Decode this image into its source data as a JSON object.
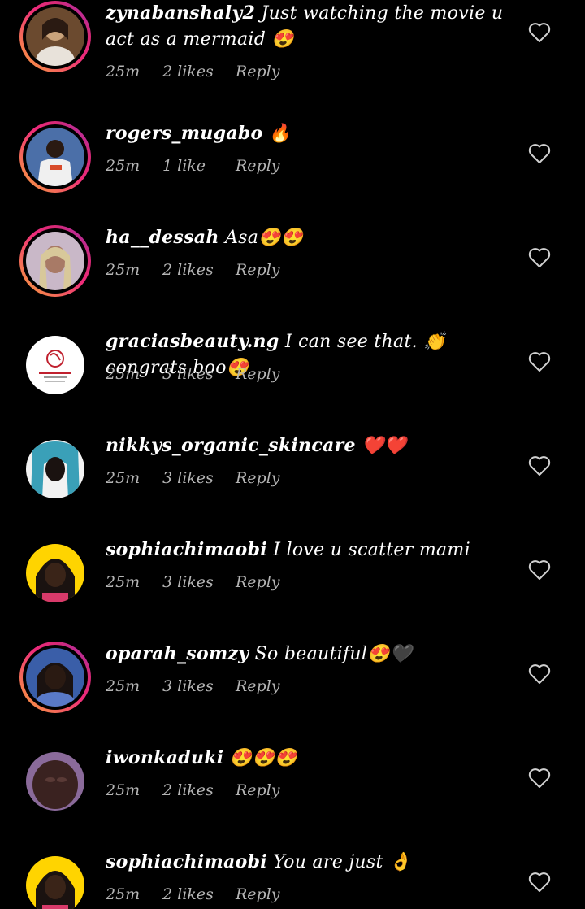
{
  "comments": [
    {
      "username": "zynabanshaly2",
      "text": "Just watching the movie u act as a mermaid 😍",
      "time": "25m",
      "likes": "2 likes",
      "reply": "Reply",
      "story": true,
      "avatar_bg": "#6b4a2f",
      "avatar_fg": "#c9a37c"
    },
    {
      "username": "rogers_mugabo",
      "text": "🔥",
      "time": "25m",
      "likes": "1 like",
      "reply": "Reply",
      "story": true,
      "avatar_bg": "#4b6fa8",
      "avatar_fg": "#2a1a12"
    },
    {
      "username": "ha__dessah",
      "text": "Asa😍😍",
      "time": "25m",
      "likes": "2 likes",
      "reply": "Reply",
      "story": true,
      "avatar_bg": "#c9b8c8",
      "avatar_fg": "#a87a66"
    },
    {
      "username": "graciasbeauty.ng",
      "text": "I can see that. 👏 congrats boo😍",
      "time": "25m",
      "likes": "3 likes",
      "reply": "Reply",
      "story": false,
      "avatar_bg": "#ffffff",
      "avatar_fg": "#c0212f"
    },
    {
      "username": "nikkys_organic_skincare",
      "text": "❤️❤️",
      "time": "25m",
      "likes": "3 likes",
      "reply": "Reply",
      "story": false,
      "avatar_bg": "#3aa0b8",
      "avatar_fg": "#1a1210"
    },
    {
      "username": "sophiachimaobi",
      "text": "I love u scatter mami",
      "time": "25m",
      "likes": "3 likes",
      "reply": "Reply",
      "story": false,
      "avatar_bg": "#ffd400",
      "avatar_fg": "#3a2418"
    },
    {
      "username": "oparah_somzy",
      "text": "So beautiful😍🖤",
      "time": "25m",
      "likes": "3 likes",
      "reply": "Reply",
      "story": true,
      "avatar_bg": "#3a5ea8",
      "avatar_fg": "#2a1a12"
    },
    {
      "username": "iwonkaduki",
      "text": "😍😍😍",
      "time": "25m",
      "likes": "2 likes",
      "reply": "Reply",
      "story": false,
      "avatar_bg": "#8a6a9a",
      "avatar_fg": "#3a2220"
    },
    {
      "username": "sophiachimaobi",
      "text": "You are just 👌",
      "time": "25m",
      "likes": "2 likes",
      "reply": "Reply",
      "story": false,
      "avatar_bg": "#ffd400",
      "avatar_fg": "#3a2418"
    }
  ],
  "icons": {
    "like": "heart-outline-icon"
  },
  "colors": {
    "background": "#000000",
    "text": "#ffffff",
    "meta": "#b5b5b5",
    "story_ring_start": "#f9a53a",
    "story_ring_end": "#d62976"
  }
}
